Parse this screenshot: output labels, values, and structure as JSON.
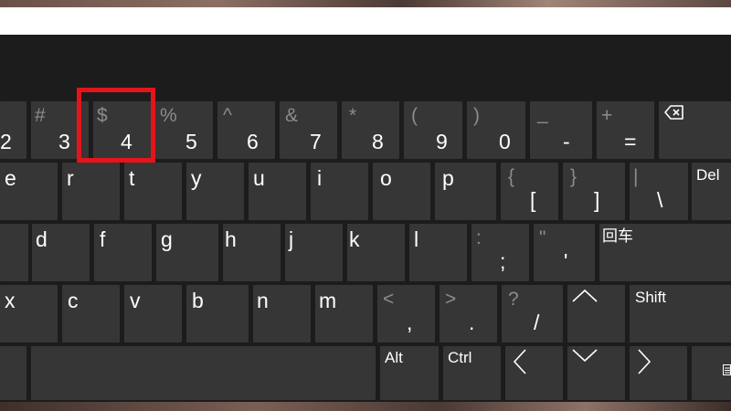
{
  "keyboard": {
    "row1": {
      "k2": {
        "main": "2"
      },
      "k3": {
        "main": "3",
        "sub": "#"
      },
      "k4": {
        "main": "4",
        "sub": "$"
      },
      "k5": {
        "main": "5",
        "sub": "%"
      },
      "k6": {
        "main": "6",
        "sub": "^"
      },
      "k7": {
        "main": "7",
        "sub": "&"
      },
      "k8": {
        "main": "8",
        "sub": "*"
      },
      "k9": {
        "main": "9",
        "sub": "("
      },
      "k0": {
        "main": "0",
        "sub": ")"
      },
      "kminus": {
        "main": "-",
        "sub": "_"
      },
      "kequals": {
        "main": "=",
        "sub": "+"
      },
      "backspace_icon": "backspace-icon"
    },
    "row2": {
      "ke": {
        "main": "e"
      },
      "kr": {
        "main": "r"
      },
      "kt": {
        "main": "t"
      },
      "ky": {
        "main": "y"
      },
      "ku": {
        "main": "u"
      },
      "ki": {
        "main": "i"
      },
      "ko": {
        "main": "o"
      },
      "kp": {
        "main": "p"
      },
      "klbracket": {
        "main": "[",
        "sub": "{"
      },
      "krbracket": {
        "main": "]",
        "sub": "}"
      },
      "kbackslash": {
        "main": "\\",
        "sub": "|"
      },
      "kdel": {
        "label": "Del"
      }
    },
    "row3": {
      "kd": {
        "main": "d"
      },
      "kf": {
        "main": "f"
      },
      "kg": {
        "main": "g"
      },
      "kh": {
        "main": "h"
      },
      "kj": {
        "main": "j"
      },
      "kk": {
        "main": "k"
      },
      "kl": {
        "main": "l"
      },
      "ksemicolon": {
        "main": ";",
        "sub": ":"
      },
      "kquote": {
        "main": "'",
        "sub": "\""
      },
      "kenter": {
        "label": "回车"
      }
    },
    "row4": {
      "kx": {
        "main": "x"
      },
      "kc": {
        "main": "c"
      },
      "kv": {
        "main": "v"
      },
      "kb": {
        "main": "b"
      },
      "kn": {
        "main": "n"
      },
      "km": {
        "main": "m"
      },
      "kcomma": {
        "main": ",",
        "sub": "<"
      },
      "kperiod": {
        "main": ".",
        "sub": ">"
      },
      "kslash": {
        "main": "/",
        "sub": "?"
      },
      "up_icon": "arrow-up-icon",
      "kshift": {
        "label": "Shift"
      }
    },
    "row5": {
      "kalt": {
        "label": "Alt"
      },
      "kctrl": {
        "label": "Ctrl"
      },
      "left_icon": "arrow-left-icon",
      "down_icon": "arrow-down-icon",
      "right_icon": "arrow-right-icon",
      "menu_icon": "keyboard-menu-icon"
    }
  },
  "highlight": {
    "target_key": "4",
    "color": "#e5141b"
  },
  "colors": {
    "key_bg": "#363636",
    "panel_bg": "#1c1c1c",
    "sub_text": "#8c8c8c"
  }
}
